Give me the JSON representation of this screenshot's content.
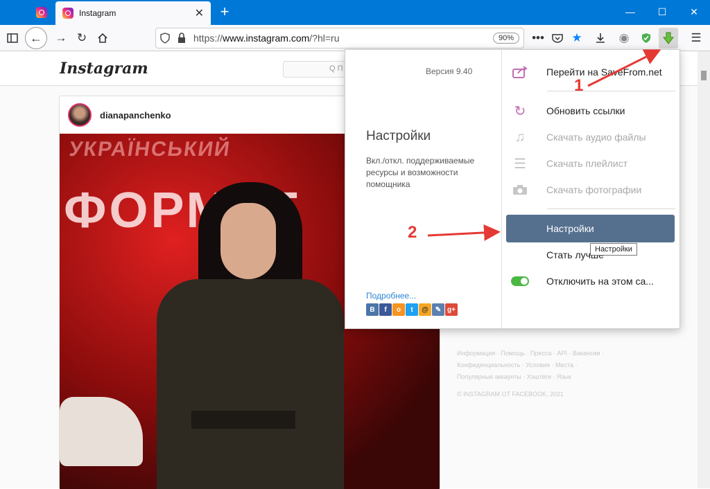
{
  "browser": {
    "tab_title": "Instagram",
    "tab_close": "✕",
    "new_tab": "+",
    "minimize": "—",
    "maximize": "☐",
    "close": "✕",
    "url_scheme": "https://",
    "url_host": "www.instagram.com",
    "url_path": "/?hl=ru",
    "zoom": "90%"
  },
  "instagram": {
    "logo": "Instagram",
    "search_placeholder": "Q П",
    "post_username": "dianapanchenko",
    "photo_text_top": "УКРАЇНСЬКИЙ",
    "photo_text_big": "ФОРМАТ",
    "footer_line1": "Информация · Помощь · Пресса · API · Вакансии ·",
    "footer_line2": "Конфиденциальность · Условия · Места ·",
    "footer_line3": "Популярные аккаунты · Хэштеги · Язык",
    "copyright": "© INSTAGRAM ОТ FACEBOOK, 2021"
  },
  "popup": {
    "version": "Версия 9.40",
    "left_title": "Настройки",
    "left_desc": "Вкл./откл. поддерживаемые ресурсы и возможности помощника",
    "more_link": "Подробнее...",
    "socials": [
      "В",
      "f",
      "o",
      "t",
      "@",
      "✎",
      "g+"
    ],
    "menu": {
      "goto_savefrom": "Перейти на SaveFrom.net",
      "refresh_links": "Обновить ссылки",
      "download_audio": "Скачать аудио файлы",
      "download_playlist": "Скачать плейлист",
      "download_photos": "Скачать фотографии",
      "settings": "Настройки",
      "be_better": "Стать лучше",
      "disable_here": "Отключить на этом са..."
    },
    "tooltip": "Настройки"
  },
  "annotations": {
    "step1": "1",
    "step2": "2",
    "color": "#e53935"
  }
}
